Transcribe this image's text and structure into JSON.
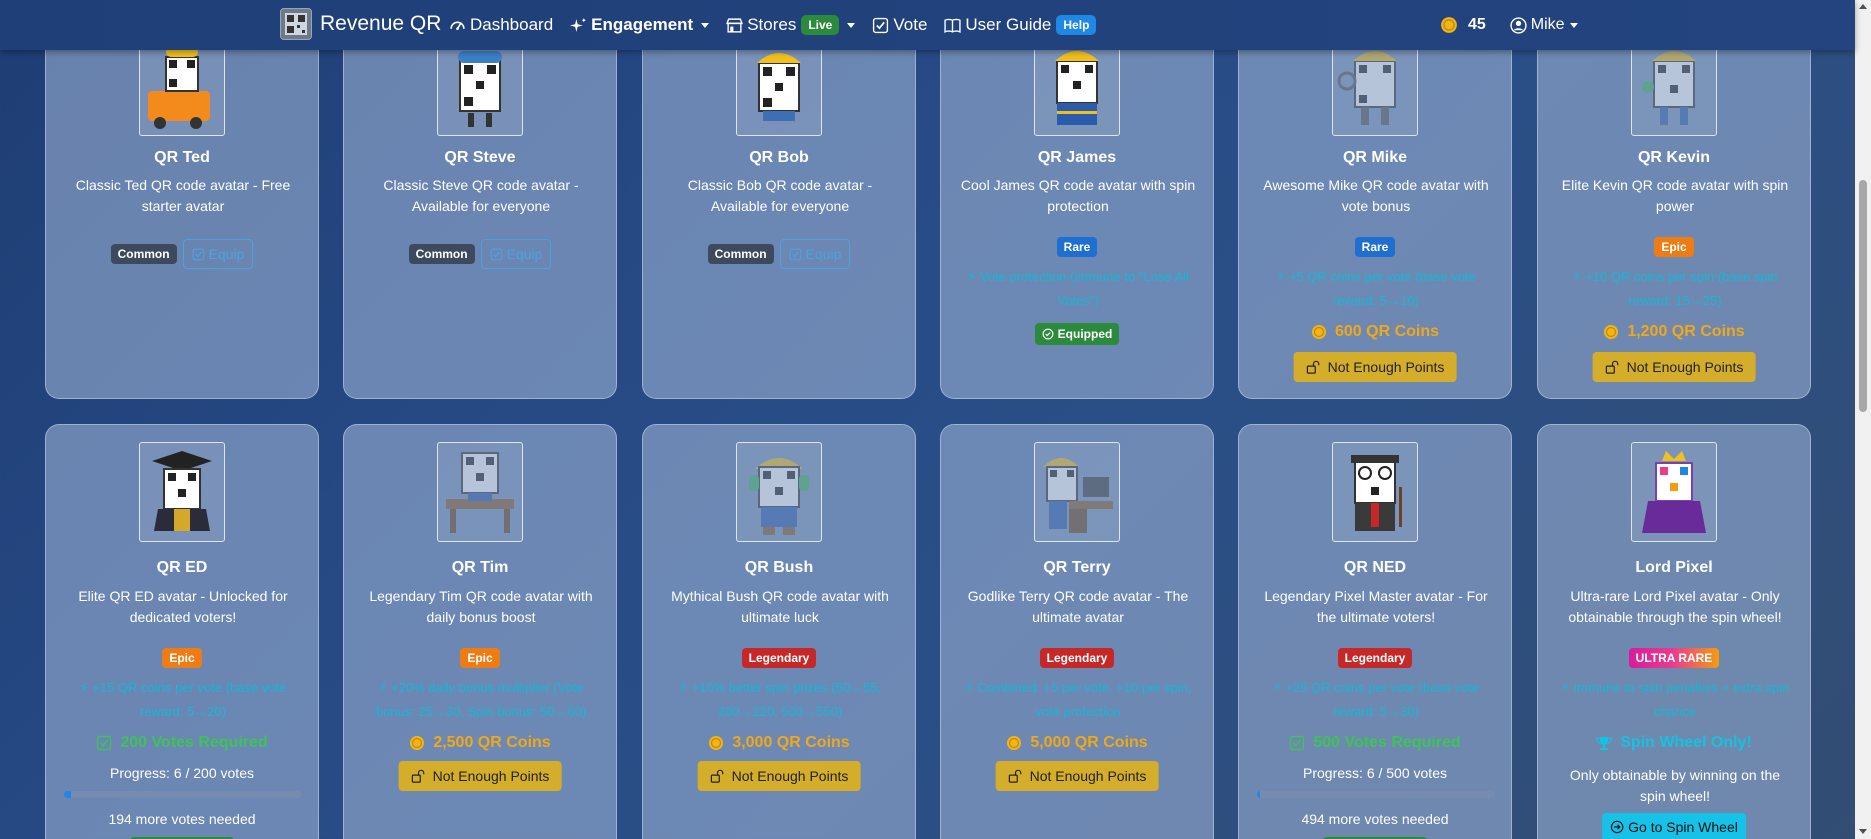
{
  "nav": {
    "brand": "Revenue QR",
    "dashboard": "Dashboard",
    "engagement": "Engagement",
    "stores": "Stores",
    "live": "Live",
    "vote": "Vote",
    "user_guide": "User Guide",
    "help": "Help",
    "points": "45",
    "user": "Mike"
  },
  "colors": {
    "common": "#3d4a5e",
    "rare": "#1f6fd1",
    "epic": "#ec7c13",
    "legendary": "#c62828",
    "equipped": "#2c8a3c",
    "price": "#f0a818",
    "bonus": "#14b8d6"
  },
  "row1": [
    {
      "name": "QR Ted",
      "desc": "Classic Ted QR code avatar - Free starter avatar",
      "rarity": "Common",
      "equip": "Equip"
    },
    {
      "name": "QR Steve",
      "desc": "Classic Steve QR code avatar - Available for everyone",
      "rarity": "Common",
      "equip": "Equip"
    },
    {
      "name": "QR Bob",
      "desc": "Classic Bob QR code avatar - Available for everyone",
      "rarity": "Common",
      "equip": "Equip"
    },
    {
      "name": "QR James",
      "desc": "Cool James QR code avatar with spin protection",
      "rarity": "Rare",
      "bonus": "Vote protection (immune to \"Lose All Votes\")",
      "status": "Equipped"
    },
    {
      "name": "QR Mike",
      "desc": "Awesome Mike QR code avatar with vote bonus",
      "rarity": "Rare",
      "bonus": "+5 QR coins per vote (base vote reward: 5→10)",
      "price": "600 QR Coins",
      "action": "Not Enough Points"
    },
    {
      "name": "QR Kevin",
      "desc": "Elite Kevin QR code avatar with spin power",
      "rarity": "Epic",
      "bonus": "+10 QR coins per spin (base spin reward: 15→25)",
      "price": "1,200 QR Coins",
      "action": "Not Enough Points"
    }
  ],
  "row2": [
    {
      "name": "QR ED",
      "desc": "Elite QR ED avatar - Unlocked for dedicated voters!",
      "rarity": "Epic",
      "bonus": "+15 QR coins per vote (base vote reward: 5→20)",
      "requirement": "200 Votes Required",
      "progress_label": "Progress: 6 / 200 votes",
      "progress": 0.03,
      "remaining": "194 more votes needed"
    },
    {
      "name": "QR Tim",
      "desc": "Legendary Tim QR code avatar with daily bonus boost",
      "rarity": "Epic",
      "bonus": "+20% daily bonus multiplier (Vote bonus: 25→30, Spin bonus: 50→60)",
      "price": "2,500 QR Coins",
      "action": "Not Enough Points"
    },
    {
      "name": "QR Bush",
      "desc": "Mythical Bush QR code avatar with ultimate luck",
      "rarity": "Legendary",
      "bonus": "+10% better spin prizes (50→55, 200→220, 500→550)",
      "price": "3,000 QR Coins",
      "action": "Not Enough Points"
    },
    {
      "name": "QR Terry",
      "desc": "Godlike Terry QR code avatar - The ultimate avatar",
      "rarity": "Legendary",
      "bonus": "Combined: +5 per vote, +10 per spin, vote protection",
      "price": "5,000 QR Coins",
      "action": "Not Enough Points"
    },
    {
      "name": "QR NED",
      "desc": "Legendary Pixel Master avatar - For the ultimate voters!",
      "rarity": "Legendary",
      "bonus": "+25 QR coins per vote (base vote reward: 5→30)",
      "requirement": "500 Votes Required",
      "progress_label": "Progress: 6 / 500 votes",
      "progress": 0.012,
      "remaining": "494 more votes needed"
    },
    {
      "name": "Lord Pixel",
      "desc": "Ultra-rare Lord Pixel avatar - Only obtainable through the spin wheel!",
      "rarity": "ULTRA RARE",
      "bonus": "Immune to spin penalties + extra spin chance",
      "requirement": "Spin Wheel Only!",
      "note": "Only obtainable by winning on the spin wheel!",
      "action": "Go to Spin Wheel"
    }
  ]
}
